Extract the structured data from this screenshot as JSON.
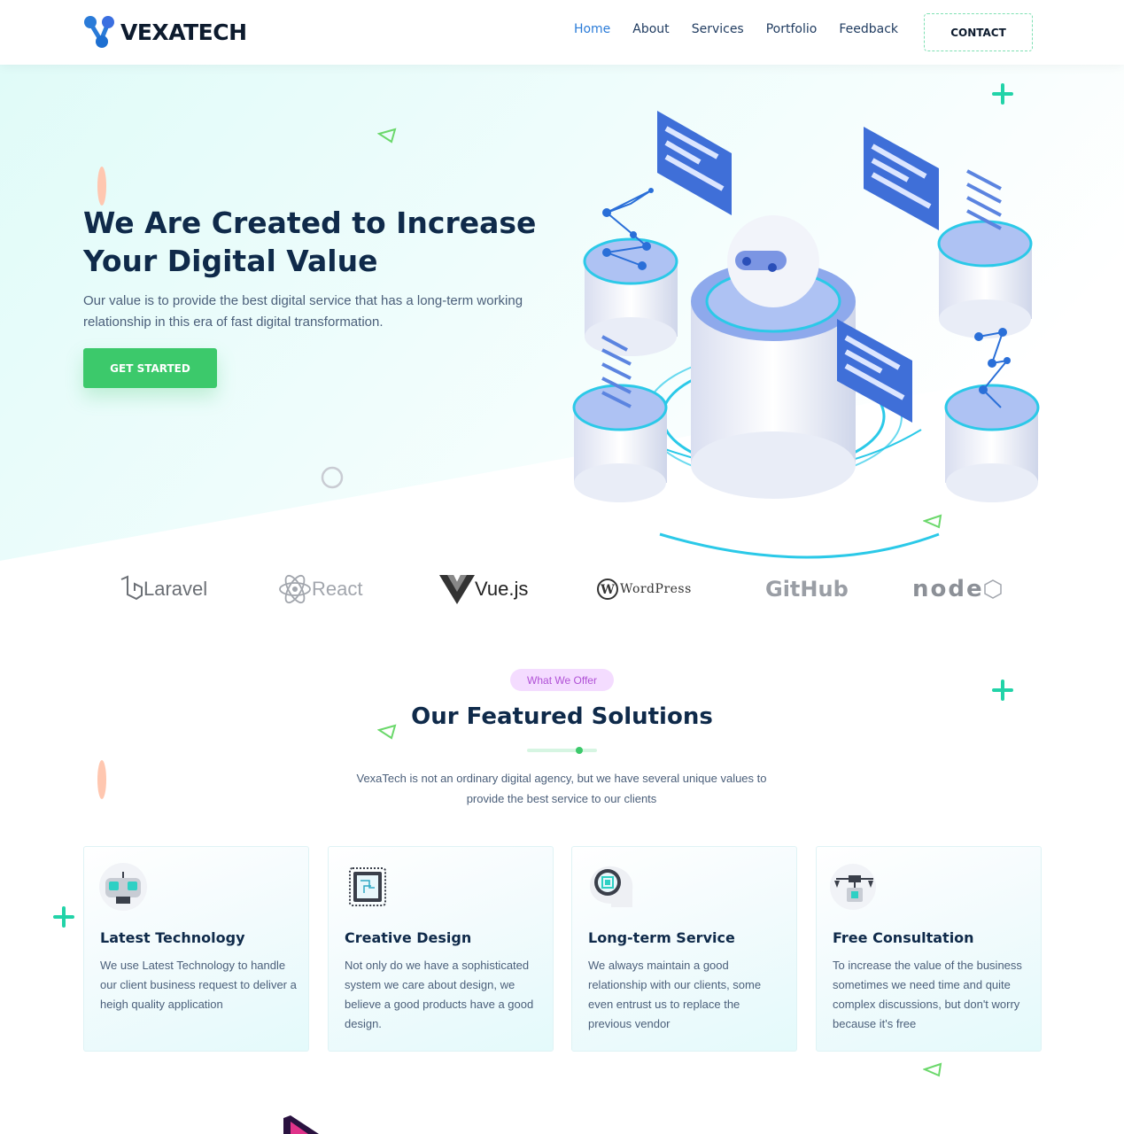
{
  "header": {
    "logo_text": "VEXATECH",
    "nav": [
      {
        "label": "Home",
        "active": true
      },
      {
        "label": "About",
        "active": false
      },
      {
        "label": "Services",
        "active": false
      },
      {
        "label": "Portfolio",
        "active": false
      },
      {
        "label": "Feedback",
        "active": false
      }
    ],
    "contact_label": "CONTACT"
  },
  "hero": {
    "title": "We Are Created to Increase Your Digital Value",
    "description": "Our value is to provide the best digital service that has a long-term working relationship in this era of fast digital transformation.",
    "cta_label": "GET STARTED"
  },
  "brands": [
    "Laravel",
    "React",
    "Vue.js",
    "WordPress",
    "GitHub",
    "node"
  ],
  "offer": {
    "badge": "What We Offer",
    "title": "Our Featured Solutions",
    "description": "VexaTech is not an ordinary digital agency, but we have several unique values to provide the best service to our clients"
  },
  "cards": [
    {
      "icon": "robot-icon",
      "title": "Latest Technology",
      "text": "We use Latest Technology to handle our client business request to deliver a heigh quality application"
    },
    {
      "icon": "chip-icon",
      "title": "Creative Design",
      "text": "Not only do we have a sophisticated system we care about design, we believe a good products have a good design."
    },
    {
      "icon": "brain-chip-icon",
      "title": "Long-term Service",
      "text": "We always maintain a good relationship with our clients, some even entrust us to replace the previous vendor"
    },
    {
      "icon": "drone-icon",
      "title": "Free Consultation",
      "text": "To increase the value of the business sometimes we need time and quite complex discussions, but don't worry because it's free"
    }
  ],
  "colors": {
    "accent_green": "#3cc96b",
    "nav_active": "#2a7bd8",
    "heading": "#0f2a4a",
    "badge_bg": "#f4dcff",
    "badge_text": "#b051d6"
  }
}
